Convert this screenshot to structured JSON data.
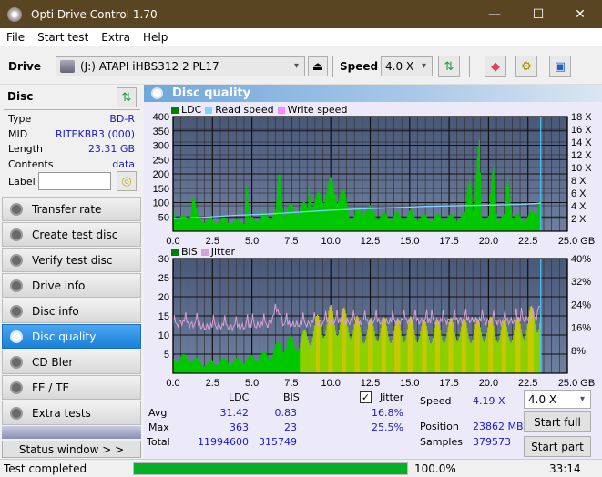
{
  "window": {
    "title": "Opti Drive Control 1.70",
    "minimize": "—",
    "maximize": "☐",
    "close": "✕"
  },
  "menu": [
    "File",
    "Start test",
    "Extra",
    "Help"
  ],
  "toolbar": {
    "drive_label": "Drive",
    "drive_value": "(J:)  ATAPI iHBS312  2 PL17",
    "speed_label": "Speed",
    "speed_value": "4.0 X"
  },
  "disc": {
    "header": "Disc",
    "rows": [
      {
        "label": "Type",
        "value": "BD-R"
      },
      {
        "label": "MID",
        "value": "RITEKBR3 (000)"
      },
      {
        "label": "Length",
        "value": "23.31 GB"
      },
      {
        "label": "Contents",
        "value": "data"
      }
    ],
    "label_field_label": "Label",
    "label_field_value": ""
  },
  "nav": [
    {
      "label": "Transfer rate",
      "active": false
    },
    {
      "label": "Create test disc",
      "active": false
    },
    {
      "label": "Verify test disc",
      "active": false
    },
    {
      "label": "Drive info",
      "active": false
    },
    {
      "label": "Disc info",
      "active": false
    },
    {
      "label": "Disc quality",
      "active": true
    },
    {
      "label": "CD Bler",
      "active": false
    },
    {
      "label": "FE / TE",
      "active": false
    },
    {
      "label": "Extra tests",
      "active": false
    }
  ],
  "status_window_button": "Status window > >",
  "panel_title": "Disc quality",
  "colors": {
    "ldc": "#00c800",
    "read_speed": "#7fd4ff",
    "write_speed": "#ff88ff",
    "bis": "#00c800",
    "jitter": "#d8a0d8",
    "plot_bg_top": "#4a5878",
    "plot_bg_bottom": "#7080a0",
    "progress": "#06b025"
  },
  "chart_data": [
    {
      "type": "area",
      "title": "LDC / Read speed",
      "legend": [
        "LDC",
        "Read speed",
        "Write speed"
      ],
      "legend_position": "top-left",
      "xlabel": "GB",
      "x_ticks": [
        "0.0",
        "2.5",
        "5.0",
        "7.5",
        "10.0",
        "12.5",
        "15.0",
        "17.5",
        "20.0",
        "22.5",
        "25.0 GB"
      ],
      "y_ticks_left": [
        "50",
        "100",
        "150",
        "200",
        "250",
        "300",
        "350",
        "400"
      ],
      "y_ticks_right": [
        "2 X",
        "4 X",
        "6 X",
        "8 X",
        "10 X",
        "12 X",
        "14 X",
        "16 X",
        "18 X"
      ],
      "xlim": [
        0,
        25
      ],
      "ylim_left": [
        0,
        400
      ],
      "ylim_right": [
        0,
        18
      ],
      "grid": true,
      "end_marker_x": 23.31,
      "series": [
        {
          "name": "LDC",
          "x": [
            0,
            0.5,
            1,
            1.2,
            1.5,
            2,
            2.5,
            3,
            3.5,
            4,
            4.5,
            4.6,
            4.8,
            5,
            5.5,
            6,
            6.5,
            6.7,
            7,
            7.5,
            8,
            8.5,
            8.6,
            8.7,
            9,
            9.5,
            10,
            10.5,
            11,
            11.2,
            11.5,
            12,
            12.5,
            13,
            13.5,
            14,
            14.5,
            15,
            15.5,
            16,
            16.5,
            17,
            17.5,
            18,
            18.5,
            18.8,
            19,
            19.4,
            19.5,
            20,
            20.3,
            20.5,
            21,
            21.2,
            21.5,
            22,
            22.5,
            23,
            23.2,
            23.31
          ],
          "y": [
            90,
            60,
            55,
            170,
            60,
            50,
            45,
            50,
            45,
            42,
            45,
            245,
            50,
            55,
            60,
            75,
            80,
            240,
            90,
            100,
            100,
            105,
            295,
            110,
            120,
            180,
            190,
            175,
            120,
            60,
            70,
            110,
            90,
            70,
            65,
            70,
            65,
            75,
            65,
            60,
            60,
            65,
            60,
            60,
            70,
            330,
            60,
            360,
            70,
            60,
            280,
            60,
            60,
            270,
            60,
            60,
            65,
            85,
            190,
            95
          ]
        },
        {
          "name": "Read speed",
          "x": [
            0,
            2,
            4,
            6,
            8,
            10,
            12,
            14,
            16,
            18,
            20,
            22,
            23.31
          ],
          "y": [
            2.0,
            2.2,
            2.5,
            2.7,
            3.0,
            3.3,
            3.5,
            3.7,
            3.9,
            4.0,
            4.1,
            4.2,
            4.4
          ]
        }
      ]
    },
    {
      "type": "bar",
      "title": "BIS / Jitter",
      "legend": [
        "BIS",
        "Jitter"
      ],
      "legend_position": "top-left",
      "xlabel": "GB",
      "x_ticks": [
        "0.0",
        "2.5",
        "5.0",
        "7.5",
        "10.0",
        "12.5",
        "15.0",
        "17.5",
        "20.0",
        "22.5",
        "25.0 GB"
      ],
      "y_ticks_left": [
        "5",
        "10",
        "15",
        "20",
        "25",
        "30"
      ],
      "y_ticks_right": [
        "8%",
        "16%",
        "24%",
        "32%",
        "40%"
      ],
      "xlim": [
        0,
        25
      ],
      "ylim_left": [
        0,
        30
      ],
      "ylim_right": [
        0,
        40
      ],
      "grid": true,
      "end_marker_x": 23.31,
      "series": [
        {
          "name": "BIS",
          "x": [
            0,
            1,
            2,
            3,
            4,
            5,
            6,
            7,
            8,
            9,
            10,
            11,
            12,
            13,
            14,
            15,
            16,
            17,
            18,
            19,
            20,
            21,
            22,
            23,
            23.31
          ],
          "y": [
            5,
            5,
            3,
            4,
            4,
            5,
            6,
            10,
            10,
            15,
            18,
            17,
            14,
            15,
            14,
            15,
            14,
            14,
            15,
            14,
            15,
            14,
            15,
            19,
            20
          ]
        },
        {
          "name": "Jitter (%)",
          "x": [
            0,
            0.5,
            1,
            1.5,
            2,
            3,
            4,
            5,
            6,
            6.7,
            7,
            8,
            9,
            10,
            11,
            12,
            13,
            14,
            15,
            16,
            17,
            18,
            19,
            20,
            21,
            22,
            23,
            23.31
          ],
          "y": [
            16,
            18,
            17,
            17,
            16,
            16.5,
            16,
            16.5,
            17,
            22,
            17,
            17,
            17.5,
            18,
            18,
            18,
            18,
            18,
            18.5,
            18,
            18,
            18.5,
            18.5,
            18,
            18,
            18.5,
            19,
            25
          ]
        }
      ]
    }
  ],
  "stats": {
    "col_ldc": "LDC",
    "col_bis": "BIS",
    "rows": [
      {
        "label": "Avg",
        "ldc": "31.42",
        "bis": "0.83",
        "jitter": "16.8%"
      },
      {
        "label": "Max",
        "ldc": "363",
        "bis": "23",
        "jitter": "25.5%"
      },
      {
        "label": "Total",
        "ldc": "11994600",
        "bis": "315749"
      }
    ],
    "jitter_label": "Jitter",
    "jitter_checked": true,
    "speed_label": "Speed",
    "speed_value": "4.19 X",
    "position_label": "Position",
    "position_value": "23862 MB",
    "samples_label": "Samples",
    "samples_value": "379573",
    "speed_select": "4.0 X",
    "start_full": "Start full",
    "start_part": "Start part"
  },
  "statusbar": {
    "text": "Test completed",
    "progress": 100.0,
    "progress_text": "100.0%",
    "time": "33:14"
  }
}
